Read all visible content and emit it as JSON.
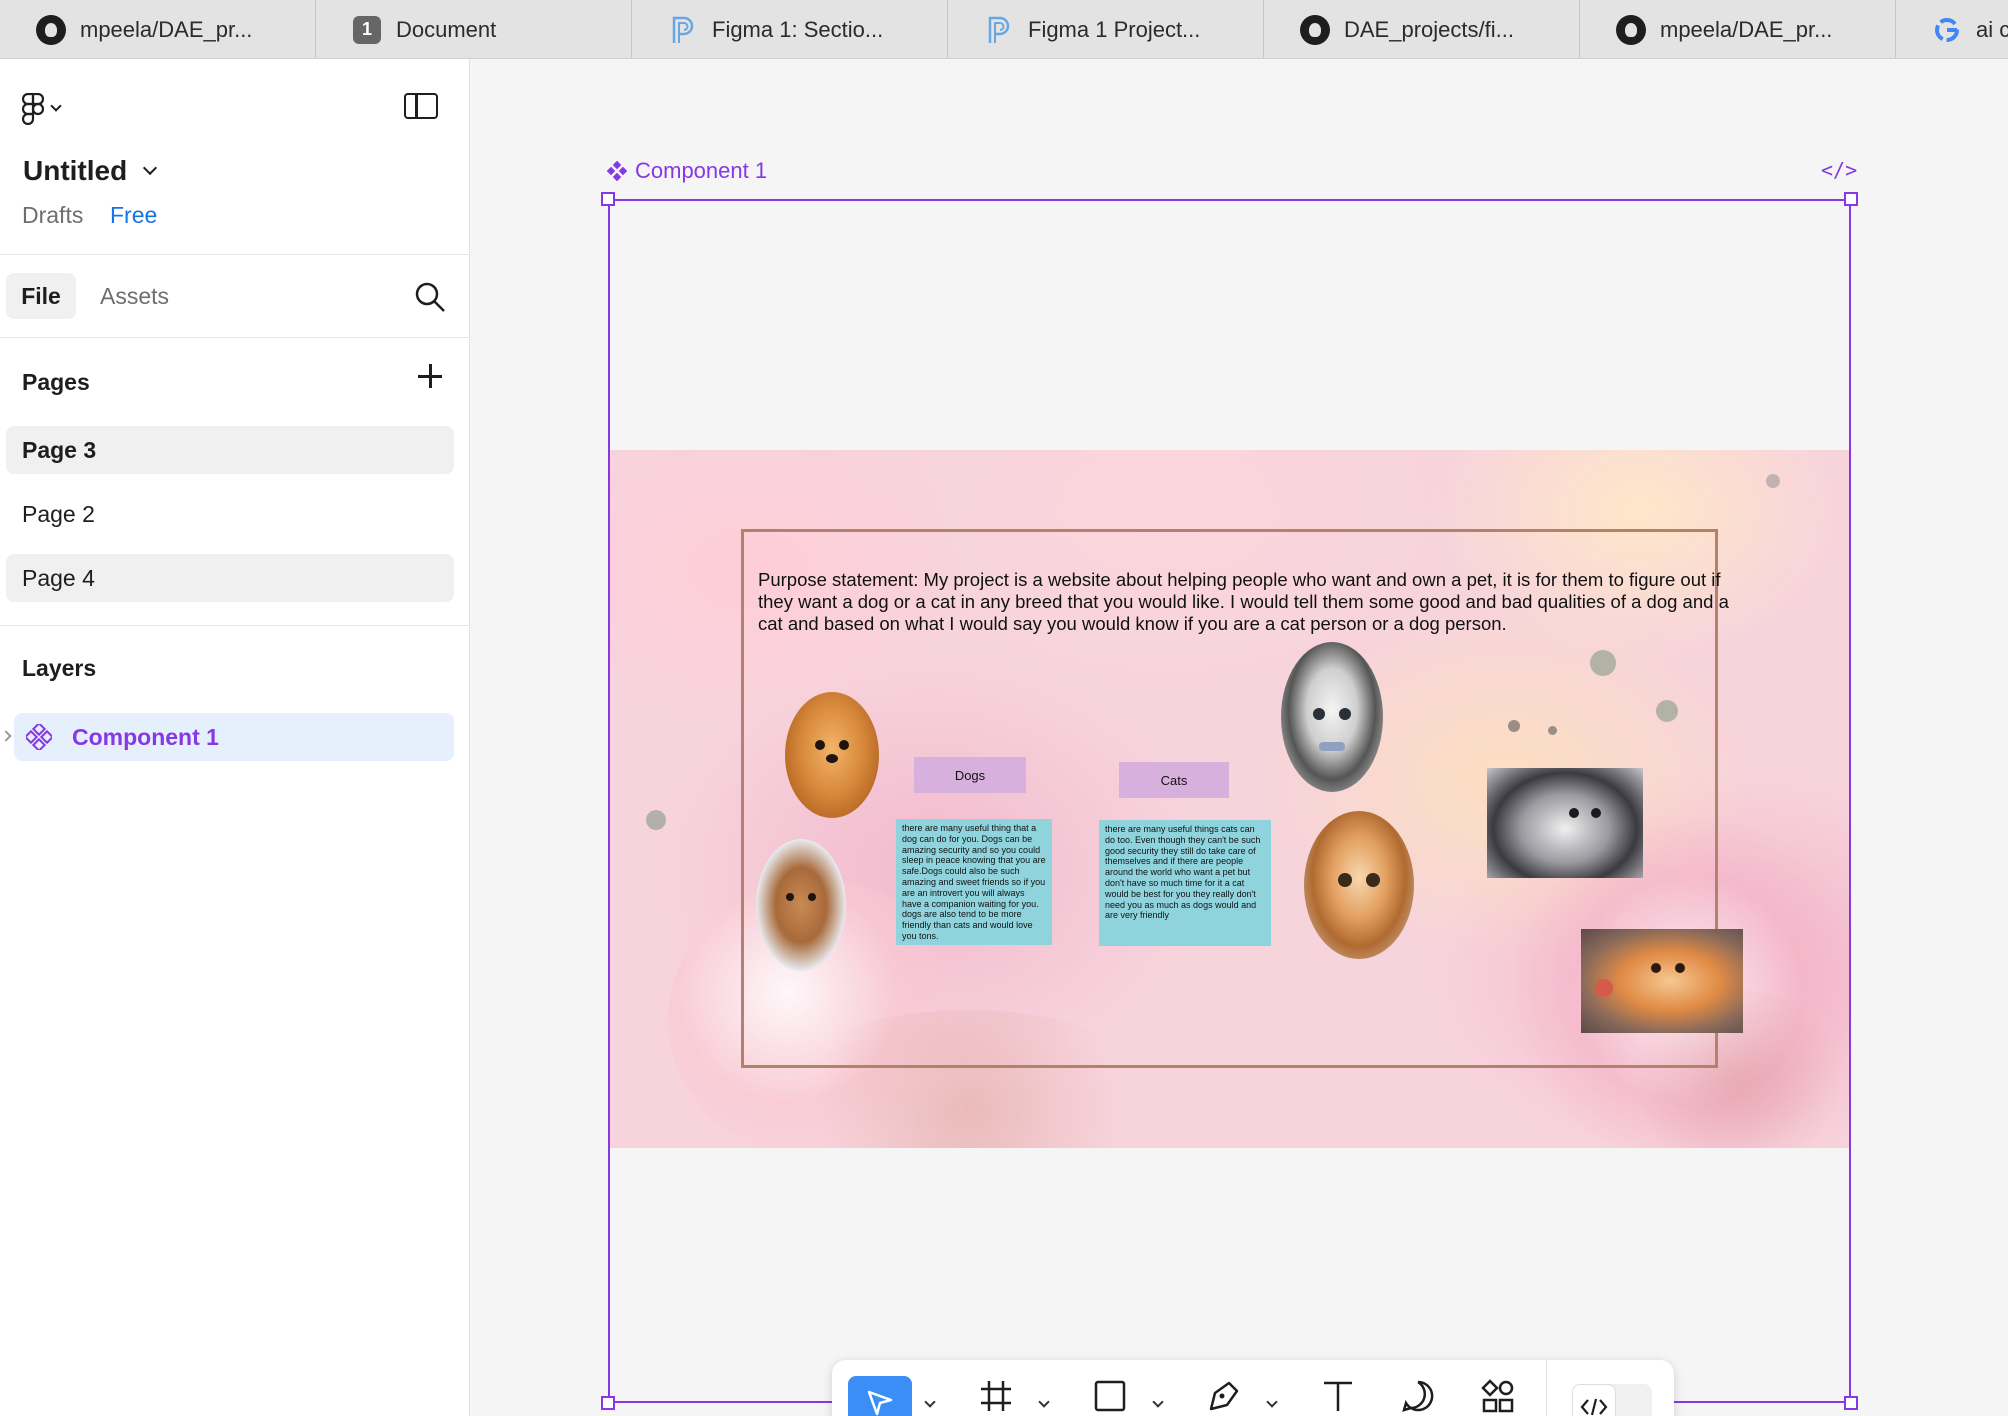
{
  "browser": {
    "tabs": [
      {
        "label": "mpeela/DAE_pr...",
        "icon": "github-icon"
      },
      {
        "label": "Document",
        "icon": "badge-1-icon",
        "badge": "1"
      },
      {
        "label": "Figma 1: Sectio...",
        "icon": "p-logo-icon"
      },
      {
        "label": "Figma 1 Project...",
        "icon": "p-logo-icon"
      },
      {
        "label": "DAE_projects/fi...",
        "icon": "github-icon"
      },
      {
        "label": "mpeela/DAE_pr...",
        "icon": "github-icon"
      },
      {
        "label": "ai c",
        "icon": "google-icon"
      }
    ]
  },
  "sidebar": {
    "file_name": "Untitled",
    "drafts": "Drafts",
    "plan": "Free",
    "tab_file": "File",
    "tab_assets": "Assets",
    "pages_header": "Pages",
    "pages": [
      {
        "label": "Page 3"
      },
      {
        "label": "Page 2"
      },
      {
        "label": "Page 4"
      }
    ],
    "layers_header": "Layers",
    "layers": [
      {
        "label": "Component 1"
      }
    ]
  },
  "canvas": {
    "frame_label": "Component 1",
    "code_icon_label": "</>",
    "design": {
      "purpose": "Purpose statement: My project is a website about helping people who want and own a pet, it is for them to figure out if they want a dog or a cat in any breed that you would like. I would tell them some good and bad qualities of a dog and a cat and based on what I would say you would know if you are a cat person or a dog person.",
      "dogs_label": "Dogs",
      "cats_label": "Cats",
      "dogs_text": "there are many useful thing that a dog can do for you. Dogs can be amazing security and so you could sleep in peace knowing that you are safe.Dogs could also be such amazing and sweet friends so if you are an introvert you will always have a companion waiting for you. dogs are also tend to be more friendly than cats and would love you tons.",
      "cats_text": "there are many useful things cats can do too. Even though they can't be such good security they still do take care of themselves and if there are people around the world who want a pet but don't have so much time for it a cat would be best for you they really don't need you as much as dogs would and are very friendly"
    }
  },
  "colors": {
    "accent": "#8638e5",
    "link": "#1473e6",
    "tool_active": "#3a8ef6",
    "label_box": "#d8b0dd",
    "text_box": "#8fd4dd"
  },
  "toolbar": {
    "tools": [
      "move-tool",
      "frame-tool",
      "rectangle-tool",
      "pen-tool",
      "text-tool",
      "comment-tool",
      "actions-tool",
      "dev-mode-toggle"
    ]
  }
}
